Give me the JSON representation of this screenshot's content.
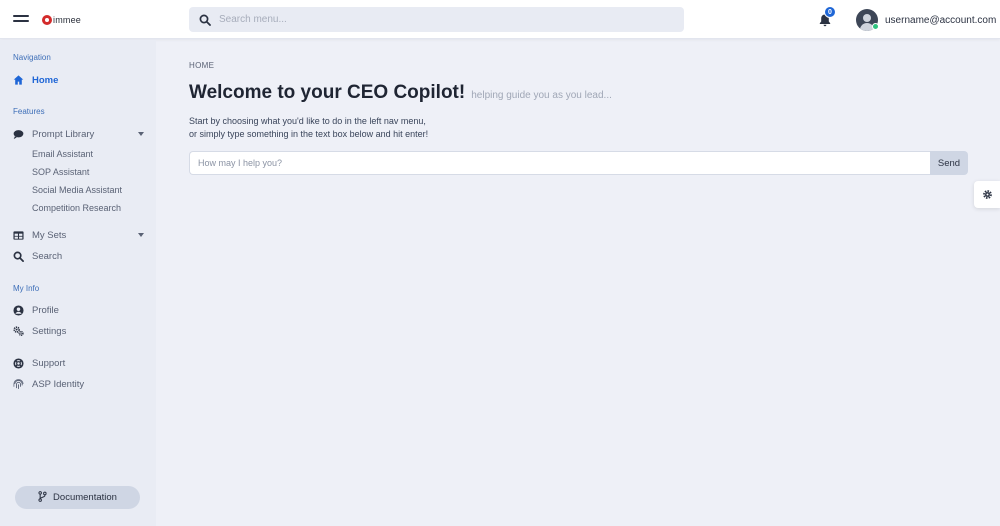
{
  "brand": {
    "logo_text": "immee",
    "accent": "#1f66d6",
    "logo_color": "#d32b2b"
  },
  "topbar": {
    "search_placeholder": "Search menu...",
    "notification_count": "0",
    "username": "username@account.com"
  },
  "sidebar": {
    "navigation_title": "Navigation",
    "home_label": "Home",
    "features_title": "Features",
    "prompt_library_label": "Prompt Library",
    "prompt_library_items": [
      "Email Assistant",
      "SOP Assistant",
      "Social Media Assistant",
      "Competition Research"
    ],
    "my_sets_label": "My Sets",
    "search_label": "Search",
    "myinfo_title": "My Info",
    "profile_label": "Profile",
    "settings_label": "Settings",
    "support_label": "Support",
    "asp_identity_label": "ASP Identity",
    "documentation_label": "Documentation"
  },
  "main": {
    "breadcrumb": "HOME",
    "title": "Welcome to your CEO Copilot!",
    "subtitle": "helping guide you as you lead...",
    "intro_line1": "Start by choosing what you'd like to do in the left nav menu,",
    "intro_line2": "or simply type something in the text box below and hit enter!",
    "ask_placeholder": "How may I help you?",
    "send_label": "Send"
  },
  "icons": {
    "menu": "hamburger-icon",
    "search": "search-icon",
    "bell": "bell-icon",
    "home": "home-icon",
    "prompt": "chat-bubble-icon",
    "sets": "table-icon",
    "profile": "user-circle-icon",
    "settings": "cogs-icon",
    "support": "life-ring-icon",
    "identity": "fingerprint-icon",
    "docs": "code-branch-icon",
    "gear": "gear-icon"
  }
}
